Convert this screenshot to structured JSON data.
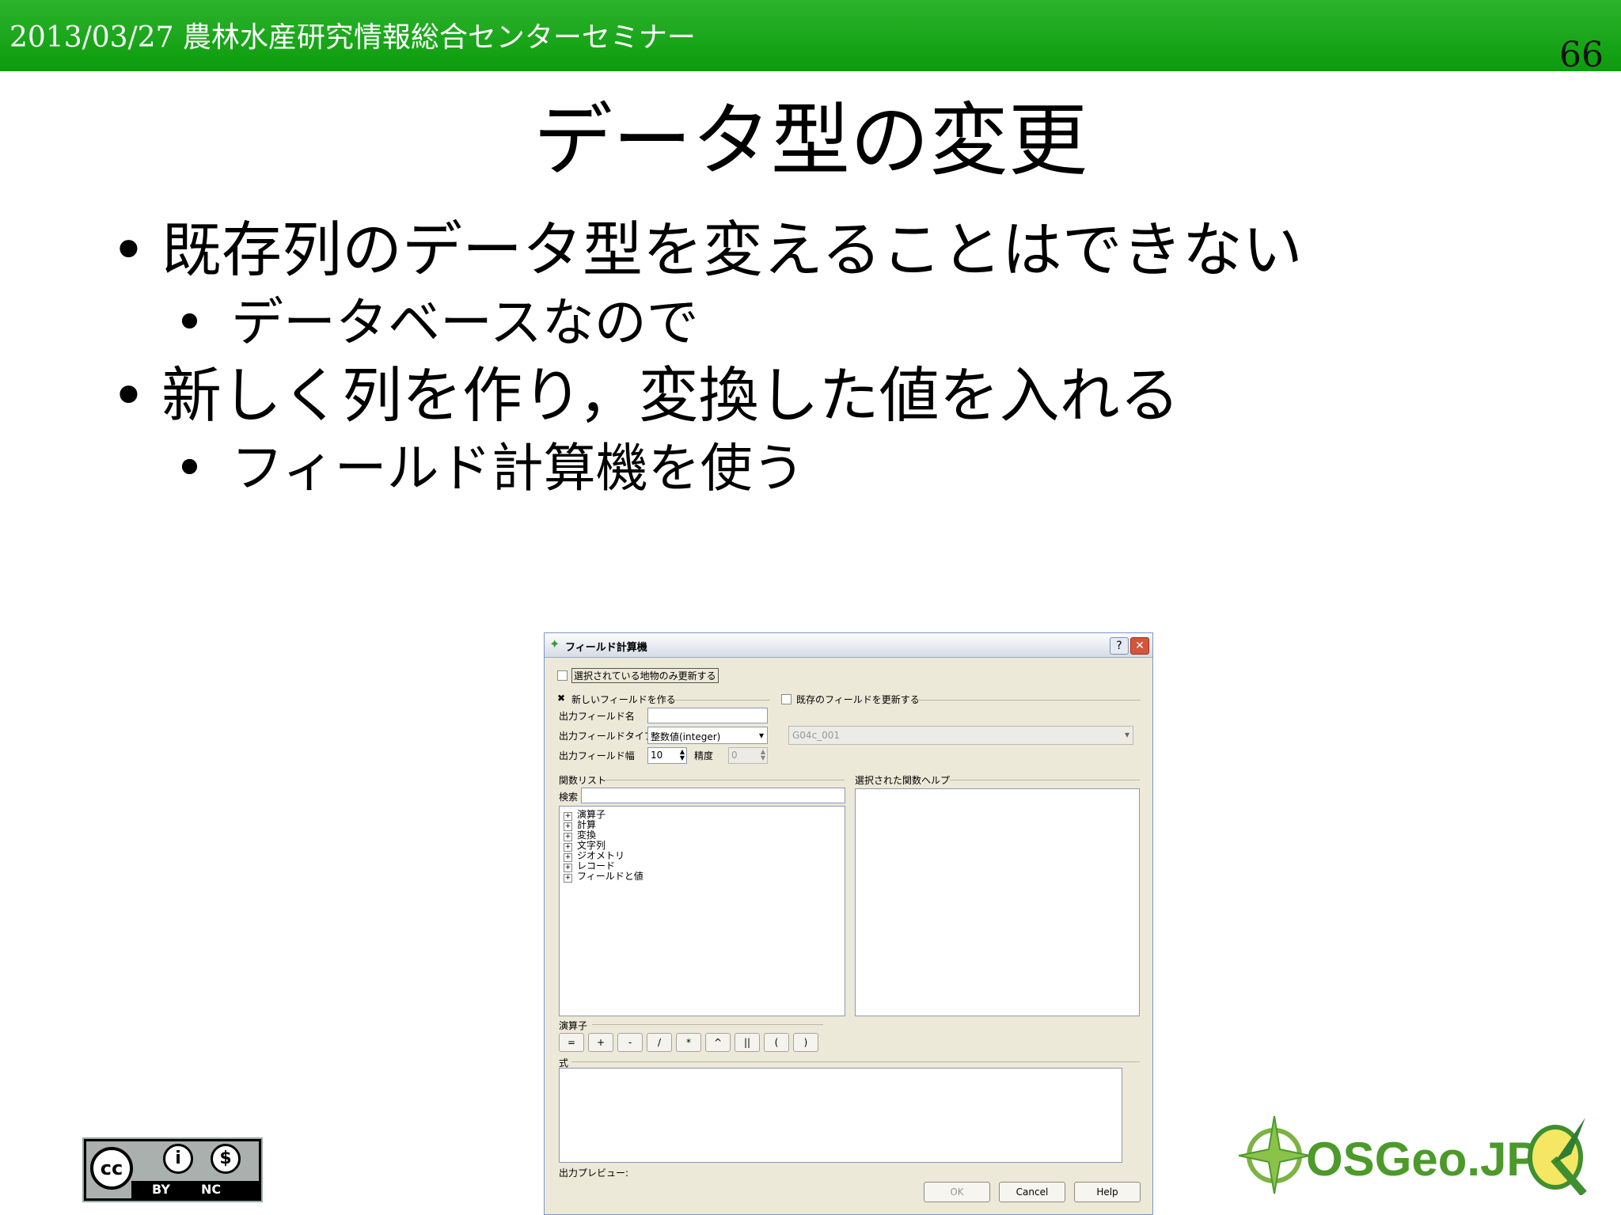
{
  "header": {
    "text": "2013/03/27 農林水産研究情報総合センターセミナー",
    "page_number": "66"
  },
  "slide": {
    "title": "データ型の変更",
    "bullets": [
      {
        "text": "既存列のデータ型を変えることはできない",
        "sub": "データベースなので"
      },
      {
        "text": "新しく列を作り，変換した値を入れる",
        "sub": "フィールド計算機を使う"
      }
    ]
  },
  "dialog": {
    "title": "フィールド計算機",
    "help_glyph": "?",
    "close_glyph": "✕",
    "update_selected_label": "選択されている地物のみ更新する",
    "new_field_label": "新しいフィールドを作る",
    "new_field_checked_glyph": "✖",
    "update_existing_label": "既存のフィールドを更新する",
    "output_name_label": "出力フィールド名",
    "output_type_label": "出力フィールドタイプ",
    "output_type_value": "整数値(integer)",
    "existing_field_value": "G04c_001",
    "output_width_label": "出力フィールド幅",
    "output_width_value": "10",
    "precision_label": "精度",
    "precision_value": "0",
    "function_list_label": "関数リスト",
    "search_label": "検索",
    "help_label": "選択された関数ヘルプ",
    "tree": [
      "演算子",
      "計算",
      "変換",
      "文字列",
      "ジオメトリ",
      "レコード",
      "フィールドと値"
    ],
    "operators_label": "演算子",
    "operators": [
      "=",
      "+",
      "-",
      "/",
      "*",
      "^",
      "||",
      "(",
      ")"
    ],
    "expression_label": "式",
    "preview_label": "出力プレビュー:",
    "ok_label": "OK",
    "cancel_label": "Cancel",
    "help_button_label": "Help"
  },
  "logos": {
    "cc_label": "cc",
    "cc_by": "BY",
    "cc_nc": "NC",
    "osgeo_text": "OSGeo.JP"
  },
  "colors": {
    "header_green": "#16a216",
    "osgeo_green": "#4c9a2a"
  }
}
